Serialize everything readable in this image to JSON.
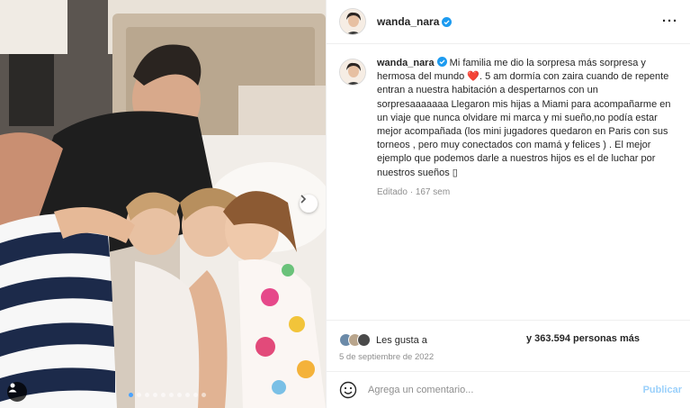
{
  "post": {
    "username": "wanda_nara",
    "more_icon": "more-options-icon",
    "caption": {
      "username": "wanda_nara",
      "part1": " Mi familia me dio la sorpresa más sorpresa y hermosa del mundo ",
      "heart": "❤️",
      "part2": ". 5 am dormía con zaira cuando de repente entran a nuestra habitación a despertarnos con un sorpresaaaaaaa Llegaron mis hijas a Miami para acompañarme en un viaje que nunca olvidare mi marca y mi sueño,no podía estar mejor acompañada (los mini jugadores quedaron en Paris con sus torneos , pero muy conectados con mamá y felices ) . El mejor ejemplo que podemos darle a nuestros hijos es el de luchar por nuestros sueños ",
      "trailing": "▯",
      "edited": "Editado",
      "age": "167 sem"
    },
    "likes": {
      "prefix": "Les gusta a",
      "suffix": "y 363.594 personas más"
    },
    "date": "5 de septiembre de 2022",
    "comment": {
      "placeholder": "Agrega un comentario...",
      "publish": "Publicar"
    },
    "carousel": {
      "slides": 10,
      "active_index": 0
    }
  },
  "colors": {
    "accent": "#0095f6",
    "verified": "#1d9bf0",
    "publish_disabled": "#9ad0fb",
    "meta_text": "#8e8e8e"
  }
}
